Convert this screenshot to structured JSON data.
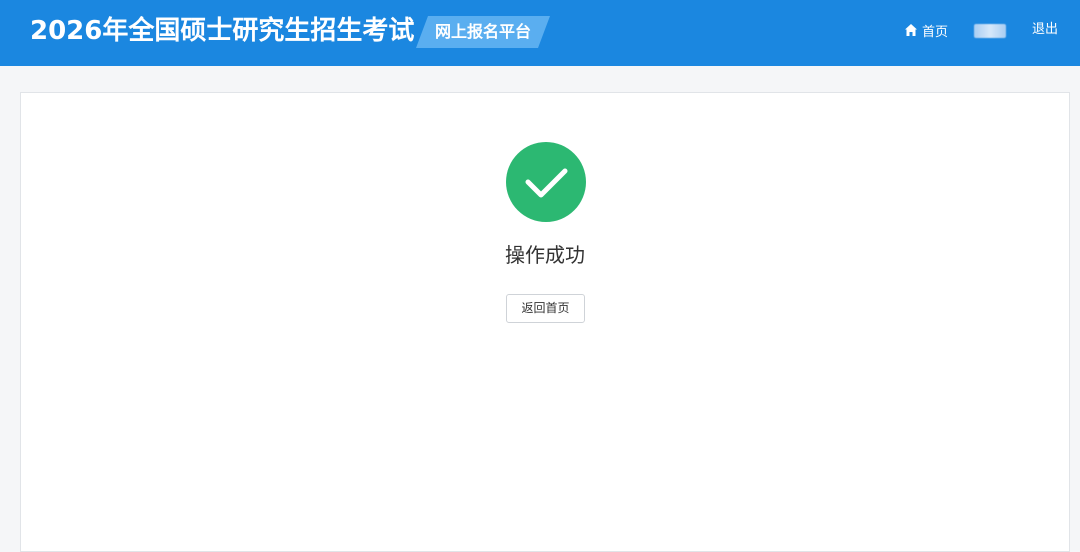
{
  "header": {
    "site_title": "2026年全国硕士研究生招生考试",
    "platform_badge": "网上报名平台",
    "nav": {
      "home_label": "首页",
      "logout_label": "退出"
    }
  },
  "result": {
    "status_icon": "check-circle-icon",
    "title": "操作成功",
    "back_button_label": "返回首页"
  },
  "colors": {
    "header_bg": "#1b87e0",
    "badge_bg": "#5aaef0",
    "success_green": "#2cb872"
  }
}
